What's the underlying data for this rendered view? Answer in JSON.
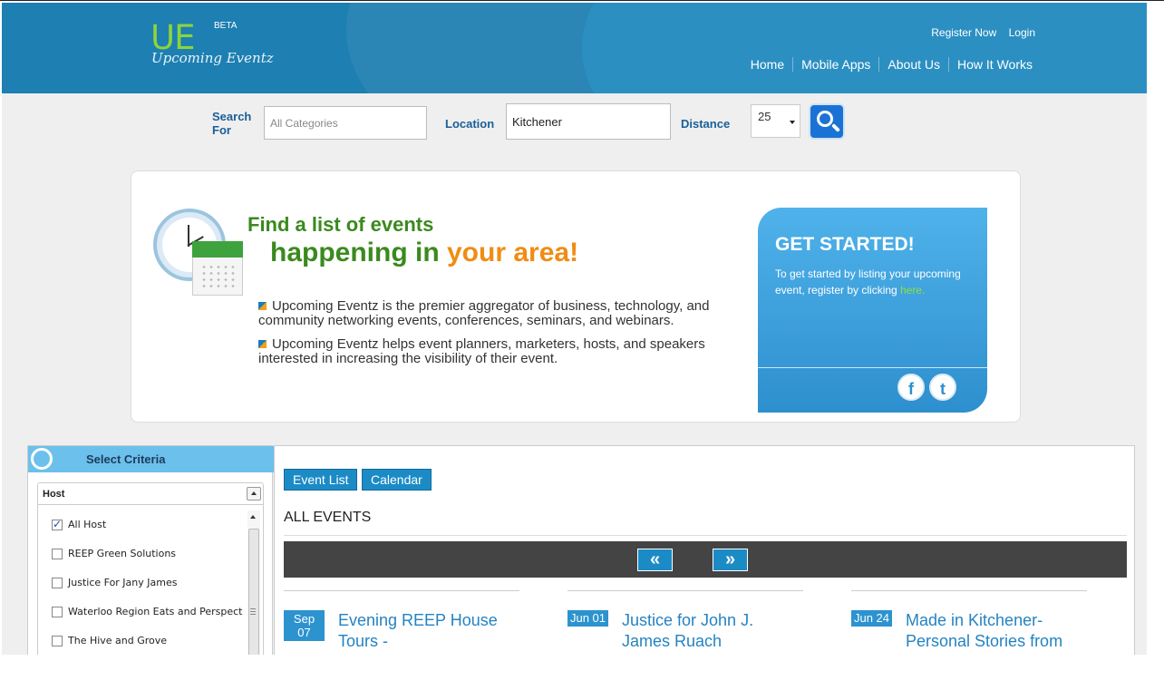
{
  "header": {
    "logo_mark": "UE",
    "logo_badge": "BETA",
    "logo_subtitle": "Upcoming Eventz",
    "register": "Register Now",
    "login": "Login",
    "nav": [
      "Home",
      "Mobile Apps",
      "About Us",
      "How It Works"
    ]
  },
  "search": {
    "search_for_label": "Search For",
    "category_placeholder": "All Categories",
    "location_label": "Location",
    "location_value": "Kitchener",
    "distance_label": "Distance",
    "distance_value": "25"
  },
  "hero": {
    "headline_1": "Find a list of events",
    "headline_2_prefix": "happening in ",
    "headline_2_accent": "your area!",
    "bullets": [
      "Upcoming Eventz is the premier aggregator of business, technology, and community networking events, conferences, seminars, and webinars.",
      "Upcoming Eventz helps event planners, marketers, hosts, and speakers interested in increasing the visibility of their event."
    ],
    "get_started_title": "GET STARTED!",
    "get_started_text": "To get started by listing your upcoming event, register by clicking ",
    "get_started_link": "here."
  },
  "criteria": {
    "title": "Select Criteria",
    "host_title": "Host",
    "hosts": [
      {
        "label": "All Host",
        "checked": true
      },
      {
        "label": "REEP Green Solutions",
        "checked": false
      },
      {
        "label": "Justice For Jany James",
        "checked": false
      },
      {
        "label": "Waterloo Region Eats and Perspect",
        "checked": false
      },
      {
        "label": "The Hive and Grove",
        "checked": false
      }
    ]
  },
  "events": {
    "tabs": [
      "Event List",
      "Calendar"
    ],
    "heading": "ALL EVENTS",
    "prev": "«",
    "next": "»",
    "items": [
      {
        "month": "Sep",
        "day": "07",
        "title_line1": "Evening REEP House",
        "title_line2": "Tours -"
      },
      {
        "date": "Jun 01",
        "title_line1": "Justice for John J.",
        "title_line2": "James Ruach"
      },
      {
        "date": "Jun 24",
        "title_line1": "Made in Kitchener-",
        "title_line2": "Personal Stories from"
      }
    ]
  },
  "colors": {
    "header_blue": "#1e7fb2",
    "brand_green": "#3a8a1e",
    "accent_orange": "#f08c14",
    "link_blue": "#2483c2"
  }
}
